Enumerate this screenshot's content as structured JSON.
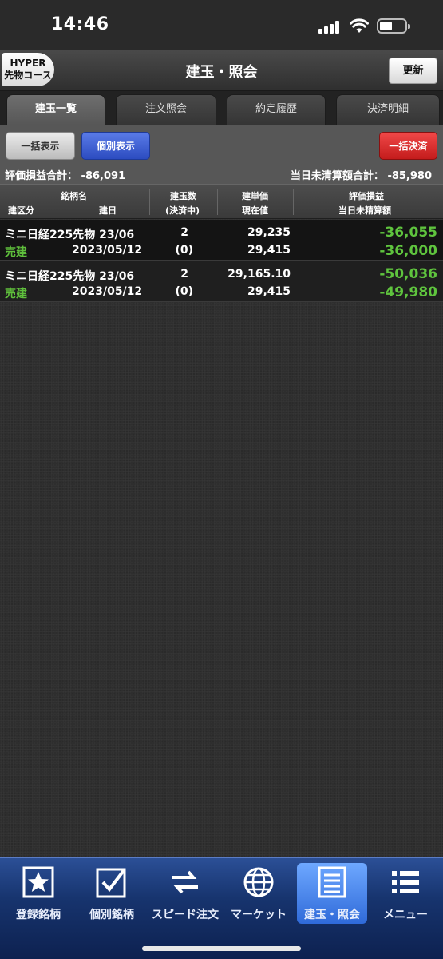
{
  "status": {
    "time": "14:46"
  },
  "header": {
    "course_line1": "HYPER",
    "course_line2": "先物コース",
    "title": "建玉・照会",
    "refresh_label": "更新"
  },
  "tabs": [
    {
      "label": "建玉一覧",
      "active": true
    },
    {
      "label": "注文照会",
      "active": false
    },
    {
      "label": "約定履歴",
      "active": false
    },
    {
      "label": "決済明細",
      "active": false
    }
  ],
  "actions": {
    "bulk_display": "一括表示",
    "individual_display": "個別表示",
    "bulk_settle": "一括決済"
  },
  "summary": {
    "eval_label": "評価損益合計：",
    "eval_value": "-86,091",
    "unsettled_label": "当日未清算額合計：",
    "unsettled_value": "-85,980"
  },
  "columns": {
    "name": "銘柄名",
    "side": "建区分",
    "date": "建日",
    "qty": "建玉数",
    "qty_sub": "(決済中)",
    "price": "建単価",
    "current": "現在値",
    "pl": "評価損益",
    "pl_sub": "当日未精算額"
  },
  "positions": [
    {
      "name": "ミニ日経225先物 23/06",
      "side": "売建",
      "date": "2023/05/12",
      "qty": "2",
      "qty_settling": "(0)",
      "price": "29,235",
      "current": "29,415",
      "pl": "-36,055",
      "unsettled": "-36,000"
    },
    {
      "name": "ミニ日経225先物 23/06",
      "side": "売建",
      "date": "2023/05/12",
      "qty": "2",
      "qty_settling": "(0)",
      "price": "29,165.10",
      "current": "29,415",
      "pl": "-50,036",
      "unsettled": "-49,980"
    }
  ],
  "bottom_tabs": [
    {
      "label": "登録銘柄",
      "icon": "star-icon"
    },
    {
      "label": "個別銘柄",
      "icon": "checkbox-icon"
    },
    {
      "label": "スピード注文",
      "icon": "swap-arrows-icon"
    },
    {
      "label": "マーケット",
      "icon": "globe-icon"
    },
    {
      "label": "建玉・照会",
      "icon": "document-list-icon"
    },
    {
      "label": "メニュー",
      "icon": "menu-list-icon"
    }
  ],
  "colors": {
    "profit_loss": "#5fc43e",
    "active_tab": "#2f6ad9",
    "settle_button": "#d42a2a",
    "individual_button": "#3a5ad0"
  }
}
